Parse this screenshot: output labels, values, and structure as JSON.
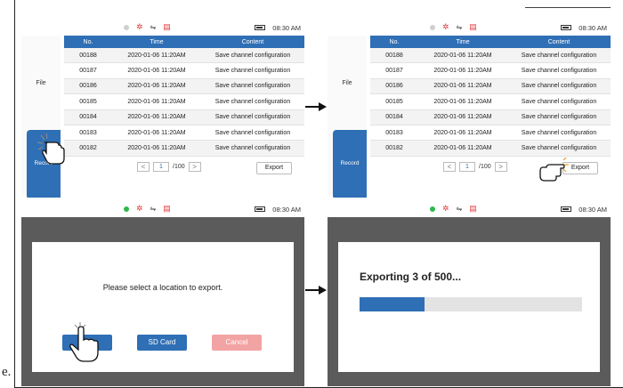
{
  "figure_label": "e.",
  "status": {
    "time": "08:30 AM"
  },
  "sidebar": {
    "file_label": "File",
    "record_label": "Record"
  },
  "table": {
    "headers": [
      "No.",
      "Time",
      "Content"
    ],
    "rows": [
      [
        "00188",
        "2020-01-06 11:20AM",
        "Save channel configuration"
      ],
      [
        "00187",
        "2020-01-06 11:20AM",
        "Save channel configuration"
      ],
      [
        "00186",
        "2020-01-06 11:20AM",
        "Save channel configuration"
      ],
      [
        "00185",
        "2020-01-06 11:20AM",
        "Save channel configuration"
      ],
      [
        "00184",
        "2020-01-06 11:20AM",
        "Save channel configuration"
      ],
      [
        "00183",
        "2020-01-06 11:20AM",
        "Save channel configuration"
      ],
      [
        "00182",
        "2020-01-06 11:20AM",
        "Save channel configuration"
      ]
    ]
  },
  "pager": {
    "prev": "<",
    "page": "1",
    "total": "/100",
    "next": ">"
  },
  "export_label": "Export",
  "dialog": {
    "message": "Please select a location to export.",
    "usb_label": "USB",
    "sd_label": "SD Card",
    "cancel_label": "Cancel"
  },
  "progress": {
    "title": "Exporting 3 of 500...",
    "fraction": 0.29
  },
  "colors": {
    "accent": "#2f6fb5",
    "cancel": "#f2a3a3",
    "overlay": "#5b5b5b"
  }
}
